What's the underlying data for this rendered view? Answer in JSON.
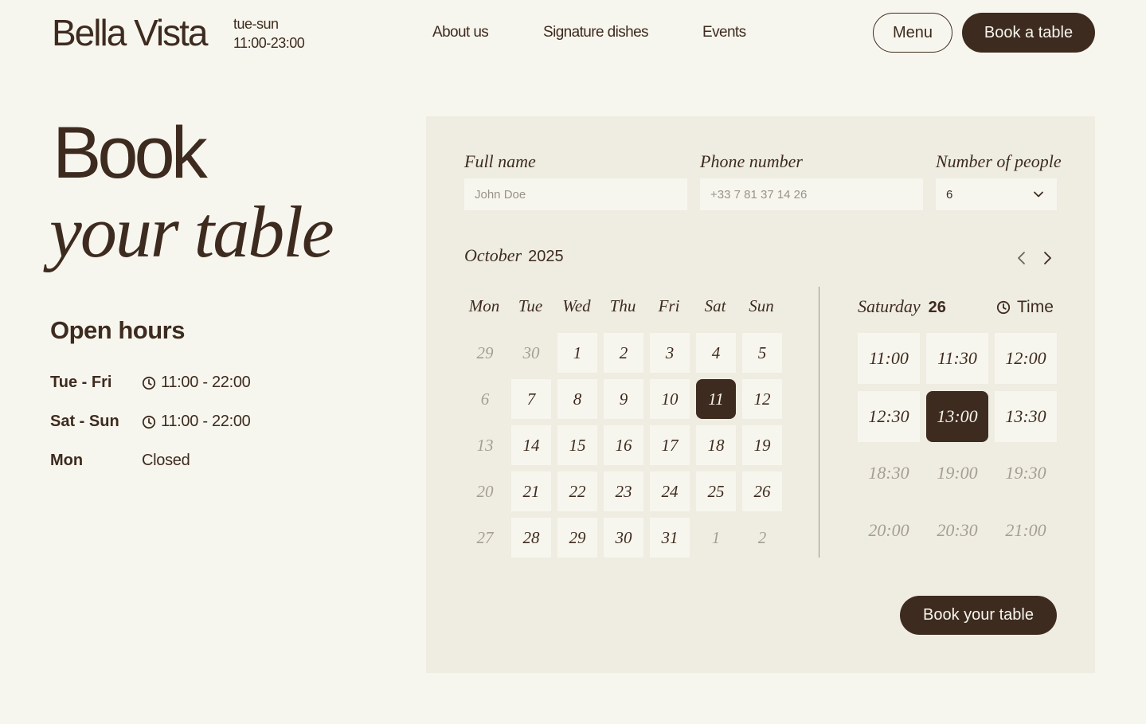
{
  "header": {
    "brand": "Bella Vista",
    "days": "tue-sun",
    "hours": "11:00-23:00",
    "nav": [
      "About us",
      "Signature dishes",
      "Events"
    ],
    "menu_label": "Menu",
    "book_label": "Book a table"
  },
  "hero": {
    "line1": "Book",
    "line2": "your table"
  },
  "open_hours": {
    "title": "Open hours",
    "rows": [
      {
        "day": "Tue - Fri",
        "value": "11:00 - 22:00",
        "icon": "clock-icon"
      },
      {
        "day": "Sat - Sun",
        "value": "11:00 - 22:00",
        "icon": "clock-icon"
      },
      {
        "day": "Mon",
        "value": "Closed",
        "icon": ""
      }
    ]
  },
  "form": {
    "name_label": "Full name",
    "name_placeholder": "John Doe",
    "phone_label": "Phone number",
    "phone_placeholder": "+33 7 81 37 14 26",
    "people_label": "Number of people",
    "people_value": "6"
  },
  "calendar": {
    "month": "October",
    "year": "2025",
    "weekdays": [
      "Mon",
      "Tue",
      "Wed",
      "Thu",
      "Fri",
      "Sat",
      "Sun"
    ],
    "weeks": [
      [
        {
          "d": "29",
          "s": "muted"
        },
        {
          "d": "30",
          "s": "muted"
        },
        {
          "d": "1",
          "s": "avail"
        },
        {
          "d": "2",
          "s": "avail"
        },
        {
          "d": "3",
          "s": "avail"
        },
        {
          "d": "4",
          "s": "avail"
        },
        {
          "d": "5",
          "s": "avail"
        }
      ],
      [
        {
          "d": "6",
          "s": "muted"
        },
        {
          "d": "7",
          "s": "avail"
        },
        {
          "d": "8",
          "s": "avail"
        },
        {
          "d": "9",
          "s": "avail"
        },
        {
          "d": "10",
          "s": "avail"
        },
        {
          "d": "11",
          "s": "sel"
        },
        {
          "d": "12",
          "s": "avail"
        }
      ],
      [
        {
          "d": "13",
          "s": "muted"
        },
        {
          "d": "14",
          "s": "avail"
        },
        {
          "d": "15",
          "s": "avail"
        },
        {
          "d": "16",
          "s": "avail"
        },
        {
          "d": "17",
          "s": "avail"
        },
        {
          "d": "18",
          "s": "avail"
        },
        {
          "d": "19",
          "s": "avail"
        }
      ],
      [
        {
          "d": "20",
          "s": "muted"
        },
        {
          "d": "21",
          "s": "avail"
        },
        {
          "d": "22",
          "s": "avail"
        },
        {
          "d": "23",
          "s": "avail"
        },
        {
          "d": "24",
          "s": "avail"
        },
        {
          "d": "25",
          "s": "avail"
        },
        {
          "d": "26",
          "s": "avail"
        }
      ],
      [
        {
          "d": "27",
          "s": "muted"
        },
        {
          "d": "28",
          "s": "avail"
        },
        {
          "d": "29",
          "s": "avail"
        },
        {
          "d": "30",
          "s": "avail"
        },
        {
          "d": "31",
          "s": "avail"
        },
        {
          "d": "1",
          "s": "muted"
        },
        {
          "d": "2",
          "s": "muted"
        }
      ]
    ]
  },
  "time": {
    "day_name": "Saturday",
    "day_num": "26",
    "label": "Time",
    "slots": [
      [
        {
          "t": "11:00",
          "s": "avail"
        },
        {
          "t": "11:30",
          "s": "avail"
        },
        {
          "t": "12:00",
          "s": "avail"
        }
      ],
      [
        {
          "t": "12:30",
          "s": "avail"
        },
        {
          "t": "13:00",
          "s": "sel"
        },
        {
          "t": "13:30",
          "s": "avail"
        }
      ],
      [
        {
          "t": "18:30",
          "s": "muted"
        },
        {
          "t": "19:00",
          "s": "muted"
        },
        {
          "t": "19:30",
          "s": "muted"
        }
      ],
      [
        {
          "t": "20:00",
          "s": "muted"
        },
        {
          "t": "20:30",
          "s": "muted"
        },
        {
          "t": "21:00",
          "s": "muted"
        }
      ]
    ]
  },
  "submit_label": "Book your table",
  "colors": {
    "background": "#f7f6ee",
    "panel": "#efede2",
    "brand_dark": "#3e2b1f",
    "muted": "#a59e92"
  }
}
